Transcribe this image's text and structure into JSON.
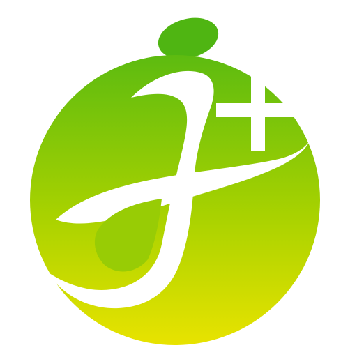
{
  "logo": {
    "name": "j-plus-logo",
    "icon": "j-plus-icon",
    "colors": {
      "gradient_top": "#5dbb10",
      "gradient_bottom": "#e8e300",
      "dot": "#4fb512",
      "mark": "#ffffff",
      "background": "#ffffff"
    }
  }
}
